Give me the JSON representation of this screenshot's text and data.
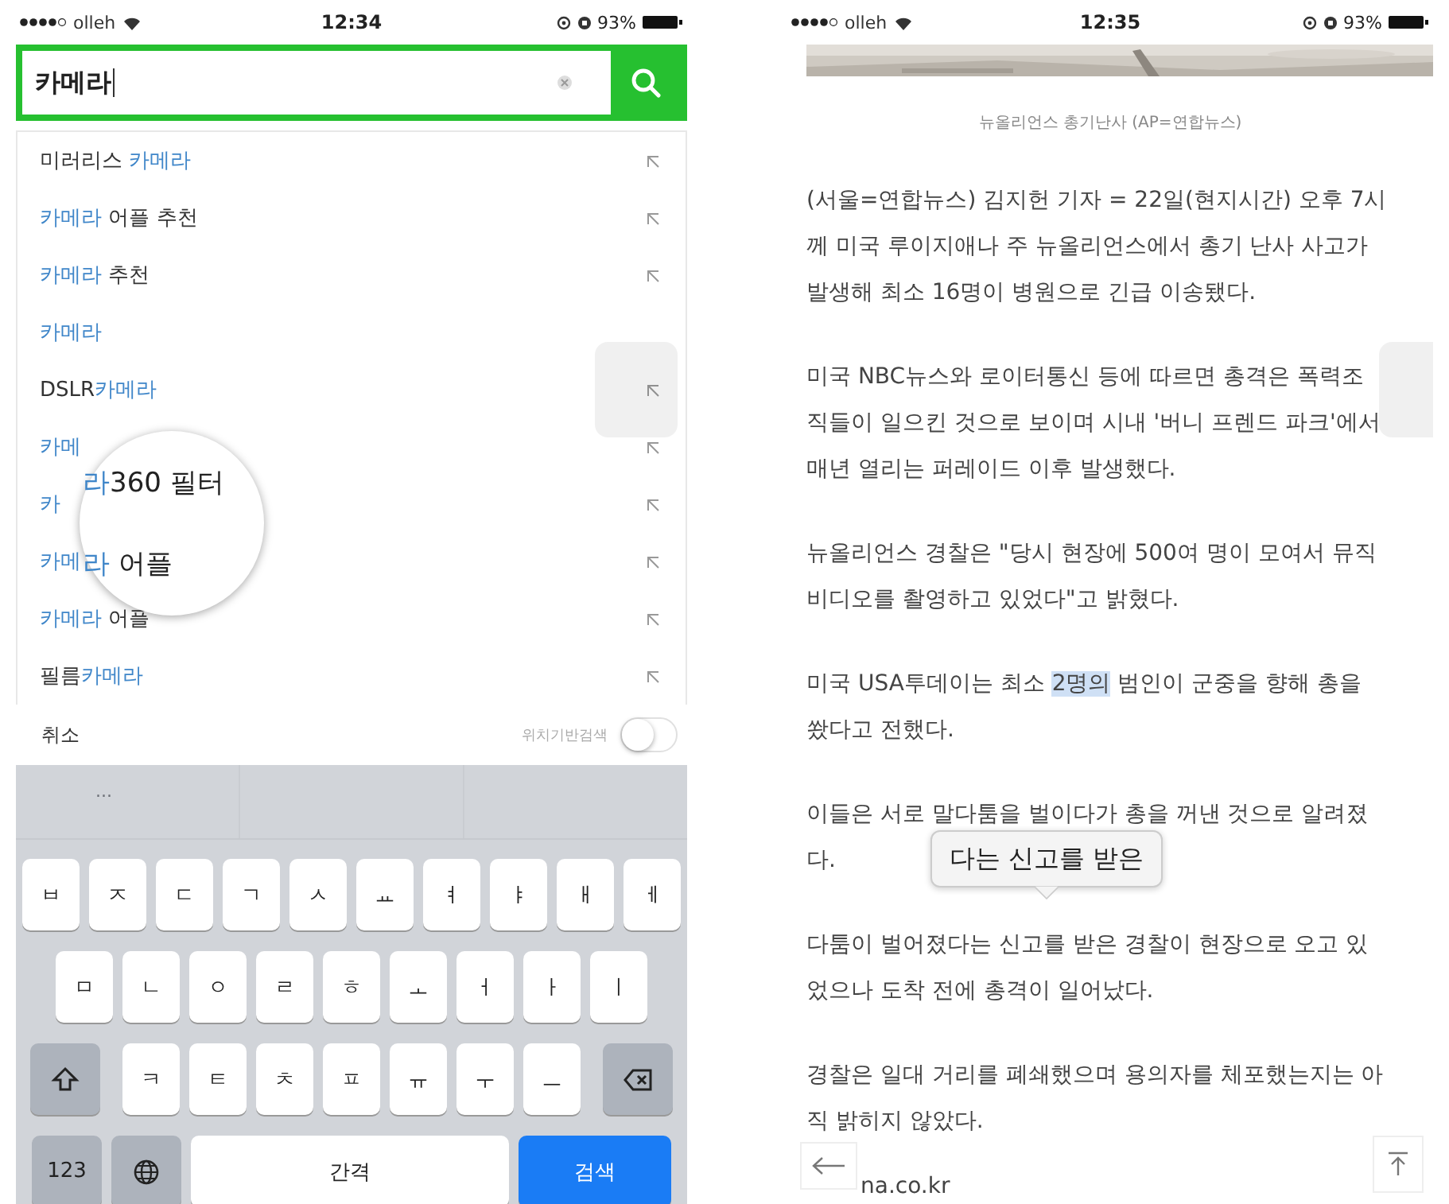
{
  "search_screen": {
    "status_bar": {
      "carrier": "olleh",
      "time": "12:34",
      "battery": "93%"
    },
    "search": {
      "value": "카메라"
    },
    "suggestions": [
      {
        "parts": [
          {
            "text": "미러리스 ",
            "highlight": false
          },
          {
            "text": "카메라",
            "highlight": true
          }
        ],
        "arrow": true
      },
      {
        "parts": [
          {
            "text": "카메라",
            "highlight": true
          },
          {
            "text": " 어플 추천",
            "highlight": false
          }
        ],
        "arrow": true
      },
      {
        "parts": [
          {
            "text": "카메라",
            "highlight": true
          },
          {
            "text": " 추천",
            "highlight": false
          }
        ],
        "arrow": true
      },
      {
        "parts": [
          {
            "text": "카메라",
            "highlight": true
          }
        ],
        "arrow": false
      },
      {
        "parts": [
          {
            "text": "DSLR",
            "highlight": false
          },
          {
            "text": "카메라",
            "highlight": true
          }
        ],
        "arrow": true
      },
      {
        "parts": [
          {
            "text": "카메",
            "highlight": true
          }
        ],
        "arrow": true
      },
      {
        "parts": [
          {
            "text": "카",
            "highlight": true
          }
        ],
        "arrow": true
      },
      {
        "parts": [
          {
            "text": "카메",
            "highlight": true
          }
        ],
        "arrow": true
      },
      {
        "parts": [
          {
            "text": "카메라",
            "highlight": true
          },
          {
            "text": " 어플",
            "highlight": false
          }
        ],
        "arrow": true
      },
      {
        "parts": [
          {
            "text": "필름",
            "highlight": false
          },
          {
            "text": "카메라",
            "highlight": true
          }
        ],
        "arrow": true
      }
    ],
    "magnifier": {
      "lines": [
        {
          "parts": [
            {
              "text": "라",
              "highlight": true
            },
            {
              "text": "360 필터",
              "highlight": false
            }
          ]
        },
        {
          "parts": [
            {
              "text": "라",
              "highlight": true
            },
            {
              "text": " 어플",
              "highlight": false
            }
          ]
        }
      ]
    },
    "footer": {
      "cancel": "취소",
      "location_label": "위치기반검색",
      "location_on": false
    },
    "keyboard": {
      "prediction": "...",
      "rows": [
        {
          "keys": [
            {
              "kind": "char",
              "label": "ㅂ"
            },
            {
              "kind": "char",
              "label": "ㅈ"
            },
            {
              "kind": "char",
              "label": "ㄷ"
            },
            {
              "kind": "char",
              "label": "ㄱ"
            },
            {
              "kind": "char",
              "label": "ㅅ"
            },
            {
              "kind": "char",
              "label": "ㅛ"
            },
            {
              "kind": "char",
              "label": "ㅕ"
            },
            {
              "kind": "char",
              "label": "ㅑ"
            },
            {
              "kind": "char",
              "label": "ㅐ"
            },
            {
              "kind": "char",
              "label": "ㅔ"
            }
          ]
        },
        {
          "keys": [
            {
              "kind": "char",
              "label": "ㅁ"
            },
            {
              "kind": "char",
              "label": "ㄴ"
            },
            {
              "kind": "char",
              "label": "ㅇ"
            },
            {
              "kind": "char",
              "label": "ㄹ"
            },
            {
              "kind": "char",
              "label": "ㅎ"
            },
            {
              "kind": "char",
              "label": "ㅗ"
            },
            {
              "kind": "char",
              "label": "ㅓ"
            },
            {
              "kind": "char",
              "label": "ㅏ"
            },
            {
              "kind": "char",
              "label": "ㅣ"
            }
          ]
        },
        {
          "keys": [
            {
              "kind": "shift"
            },
            {
              "kind": "char",
              "label": "ㅋ"
            },
            {
              "kind": "char",
              "label": "ㅌ"
            },
            {
              "kind": "char",
              "label": "ㅊ"
            },
            {
              "kind": "char",
              "label": "ㅍ"
            },
            {
              "kind": "char",
              "label": "ㅠ"
            },
            {
              "kind": "char",
              "label": "ㅜ"
            },
            {
              "kind": "char",
              "label": "ㅡ"
            },
            {
              "kind": "delete"
            }
          ]
        },
        {
          "keys": [
            {
              "kind": "mode",
              "label": "123"
            },
            {
              "kind": "globe"
            },
            {
              "kind": "space",
              "label": "간격"
            },
            {
              "kind": "action",
              "label": "검색"
            }
          ]
        }
      ]
    }
  },
  "article_screen": {
    "status_bar": {
      "carrier": "olleh",
      "time": "12:35",
      "battery": "93%"
    },
    "caption": "뉴올리언스 총기난사 (AP=연합뉴스)",
    "paragraphs": [
      {
        "lines": [
          "(서울=연합뉴스) 김지헌 기자 = 22일(현지시간) 오후 7시",
          "께 미국 루이지애나 주 뉴올리언스에서 총기 난사 사고가",
          "발생해 최소 16명이 병원으로 긴급 이송됐다."
        ]
      },
      {
        "lines": [
          "미국 NBC뉴스와 로이터통신 등에 따르면 총격은 폭력조",
          "직들이 일으킨 것으로 보이며 시내 '버니 프렌드 파크'에서",
          "매년 열리는 퍼레이드 이후 발생했다."
        ]
      },
      {
        "lines": [
          "뉴올리언스 경찰은 \"당시 현장에 500여 명이 모여서 뮤직",
          "비디오를 촬영하고 있었다\"고 밝혔다."
        ]
      },
      {
        "lines": [
          {
            "parts": [
              {
                "text": "미국 USA투데이는 최소 ",
                "selected": false
              },
              {
                "text": "2명의",
                "selected": true
              },
              {
                "text": " 범인이 군중을 향해 총을",
                "selected": false
              }
            ]
          },
          "쐈다고 전했다."
        ]
      },
      {
        "lines": [
          "이들은 서로 말다툼을 벌이다가 총을 꺼낸 것으로 알려졌",
          "다."
        ]
      },
      {
        "lines": [
          "다툼이 벌어졌다는 신고를 받은 경찰이 현장으로 오고 있",
          "었으나 도착 전에 총격이 일어났다."
        ]
      },
      {
        "lines": [
          "경찰은 일대 거리를 폐쇄했으며 용의자를 체포했는지는 아",
          "직 밝히지 않았다."
        ]
      }
    ],
    "magnifier": {
      "text": "다는 신고를 받은"
    },
    "source": "na.co.kr"
  }
}
